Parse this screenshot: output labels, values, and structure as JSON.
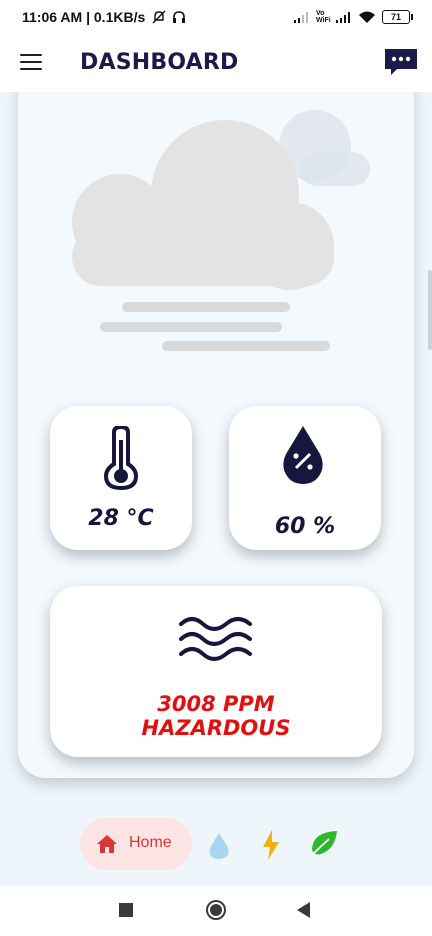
{
  "status_bar": {
    "time": "11:06 AM",
    "separator": "|",
    "speed": "0.1KB/s",
    "network": "Vo WiFi",
    "battery": "71"
  },
  "app_bar": {
    "title": "DASHBOARD",
    "menu_icon": "hamburger-menu-icon",
    "chat_icon": "chat-bubble-icon"
  },
  "weather": {
    "icon": "cloud-icon"
  },
  "temperature": {
    "value": "28 °C",
    "icon": "thermometer-icon"
  },
  "humidity": {
    "value": "60 %",
    "icon": "water-drop-percent-icon"
  },
  "air_quality": {
    "ppm": "3008 PPM",
    "status": "HAZARDOUS",
    "status_color": "#e01010",
    "icon": "air-waves-icon"
  },
  "bottom_nav": {
    "items": [
      {
        "label": "Home",
        "icon": "home-icon",
        "active": true,
        "color": "#d93636"
      },
      {
        "label": "",
        "icon": "water-drop-icon",
        "color": "#a9d6ee"
      },
      {
        "label": "",
        "icon": "lightning-icon",
        "color": "#f2b10f"
      },
      {
        "label": "",
        "icon": "leaf-icon",
        "color": "#2eb82e"
      }
    ]
  },
  "system_nav": {
    "items": [
      "recents-icon",
      "home-circle-icon",
      "back-icon"
    ]
  },
  "colors": {
    "primary": "#1b1b4a",
    "background": "#eef5fb",
    "alert": "#e01010"
  }
}
